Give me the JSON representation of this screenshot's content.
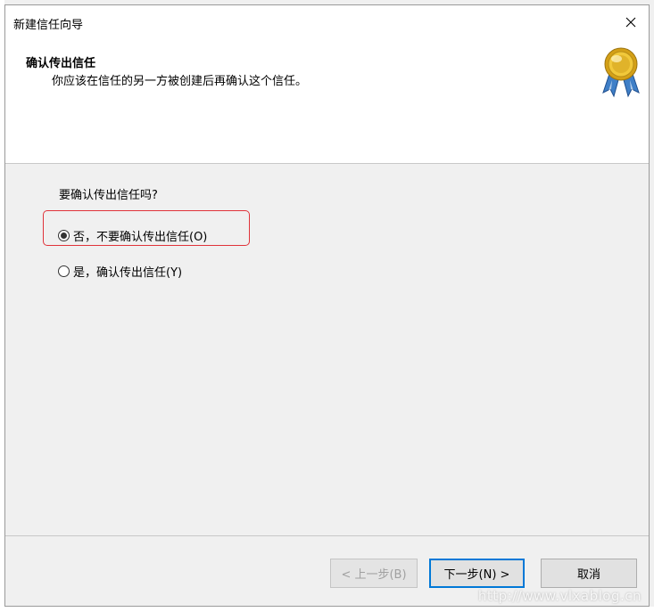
{
  "window": {
    "title": "新建信任向导",
    "close_glyph": "✕"
  },
  "header": {
    "title": "确认传出信任",
    "subtitle": "你应该在信任的另一方被创建后再确认这个信任。",
    "icon": "certificate-medal-icon"
  },
  "body": {
    "question": "要确认传出信任吗?",
    "options": [
      {
        "label": "否，不要确认传出信任(O)",
        "checked": true
      },
      {
        "label": "是，确认传出信任(Y)",
        "checked": false
      }
    ]
  },
  "footer": {
    "back_label": "< 上一步(B)",
    "next_label": "下一步(N) >",
    "cancel_label": "取消"
  },
  "watermark": "http://www.vlxablog.cn",
  "colors": {
    "highlight": "#e0333a",
    "default_button_border": "#0078d7",
    "dialog_bg": "#f0f0f0"
  }
}
